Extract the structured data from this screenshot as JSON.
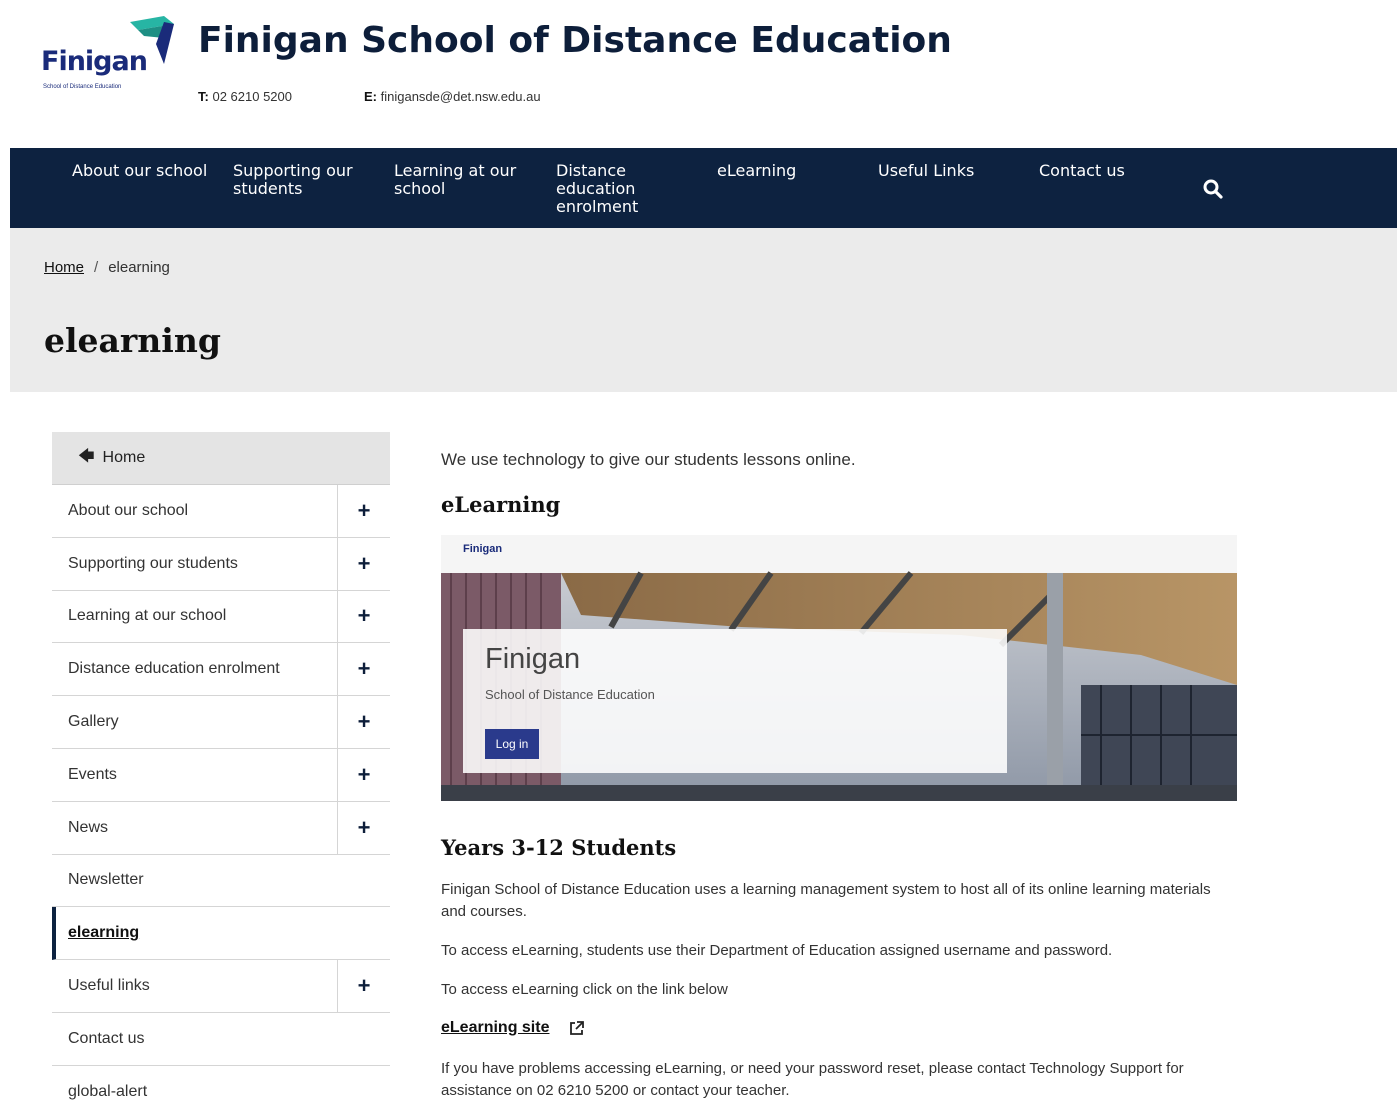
{
  "header": {
    "logo_word": "Finigan",
    "logo_sub": "School of Distance Education",
    "title": "Finigan School of Distance Education",
    "phone_label": "T:",
    "phone_value": "02 6210 5200",
    "email_label": "E:",
    "email_value": "finigansde@det.nsw.edu.au"
  },
  "nav": {
    "items": [
      {
        "label": "About our school"
      },
      {
        "label": "Supporting our students"
      },
      {
        "label": "Learning at our school"
      },
      {
        "label": "Distance education enrolment"
      },
      {
        "label": "eLearning"
      },
      {
        "label": "Useful Links"
      },
      {
        "label": "Contact us"
      }
    ],
    "search_icon": "search-icon"
  },
  "breadcrumb": {
    "home": "Home",
    "separator": "/",
    "current": "elearning"
  },
  "page_title": "elearning",
  "sidebar": {
    "home_label": "Home",
    "items": [
      {
        "label": "About our school",
        "expandable": true
      },
      {
        "label": "Supporting our students",
        "expandable": true
      },
      {
        "label": "Learning at our school",
        "expandable": true
      },
      {
        "label": "Distance education enrolment",
        "expandable": true
      },
      {
        "label": "Gallery",
        "expandable": true
      },
      {
        "label": "Events",
        "expandable": true
      },
      {
        "label": "News",
        "expandable": true
      },
      {
        "label": "Newsletter",
        "expandable": false
      },
      {
        "label": "elearning",
        "expandable": false,
        "active": true
      },
      {
        "label": "Useful links",
        "expandable": true
      },
      {
        "label": "Contact us",
        "expandable": false
      },
      {
        "label": "global-alert",
        "expandable": false
      }
    ],
    "expand_symbol": "+"
  },
  "main": {
    "intro": "We use technology to give our students lessons online.",
    "heading_elearning": "eLearning",
    "screenshot": {
      "logo_word": "Finigan",
      "card_title": "Finigan",
      "card_subtitle": "School of Distance Education",
      "login_button": "Log in"
    },
    "heading_years": "Years 3-12 Students",
    "para1": "Finigan School of Distance Education uses a learning management system to host all of its online learning materials and courses.",
    "para2": "To access eLearning, students use their Department of Education assigned username and password.",
    "para3": "To access eLearning click on the link below",
    "link_label": "eLearning site",
    "para4": "If you have problems accessing eLearning, or need your password reset, please contact Technology Support for assistance on 02 6210 5200 or contact your teacher."
  },
  "colors": {
    "nav_bg": "#0d2240",
    "banner_bg": "#ebebeb",
    "brand_blue": "#1a2b7a",
    "brand_teal": "#27b5a4"
  }
}
